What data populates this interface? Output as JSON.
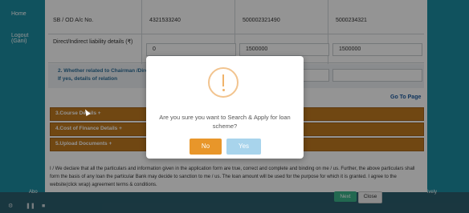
{
  "nav": {
    "home": "Home",
    "logout": "Logout (Gani)"
  },
  "table": {
    "row1": {
      "label": "SB / OD A/c No.",
      "v1": "4321533240",
      "v2": "500002321490",
      "v3": "5000234321"
    },
    "row2": {
      "label": "Direct/Indirect liability details (₹)",
      "v1": "0",
      "v2": "1500000",
      "v3": "1500000"
    }
  },
  "question2": "2. Whether related to Chairman /Direct other Banks. If yes, details of relation",
  "go_to_page": "Go To Page",
  "sections": [
    "3.Course Details +",
    "4.Cost of Finance Details +",
    "5.Upload Documents +"
  ],
  "declaration": "I / We declare that all the particulars and information given in the application form are true, correct and complete and binding on me / us. Further, the above particulars shall form the basis of any loan the particular Bank may decide to sanction to me / us. The loan amount will be used for the purpose for which it is granted. I agree to the website(click wrap) agreement terms & conditions.",
  "buttons": {
    "next": "Next",
    "close": "Close"
  },
  "footer": {
    "about": "Abo",
    "right": "ively"
  },
  "modal": {
    "message": "Are you sure you want to Search & Apply for loan scheme?",
    "no": "No",
    "yes": "Yes"
  },
  "colors": {
    "accent": "#1d8ea3",
    "section": "#c27a1f",
    "no_btn": "#e8962a",
    "yes_btn": "#a8d4ec"
  }
}
